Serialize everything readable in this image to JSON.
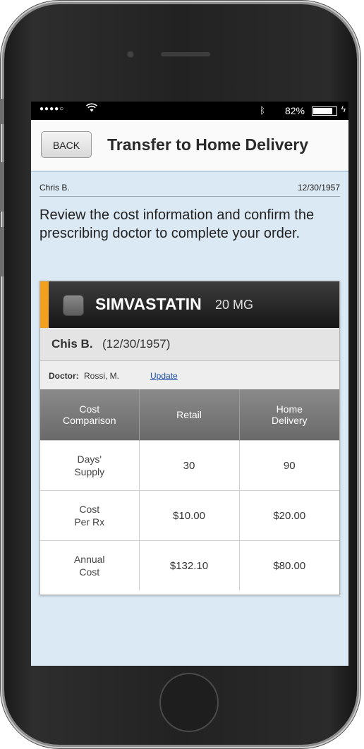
{
  "status_bar": {
    "signal": "●●●●○",
    "battery_percent": "82%",
    "battery_level": 0.82
  },
  "nav": {
    "back_label": "BACK",
    "title": "Transfer to Home Delivery"
  },
  "patient": {
    "name": "Chris B.",
    "dob": "12/30/1957"
  },
  "instructions": "Review the cost information and confirm the prescribing doctor to complete your order.",
  "prescription": {
    "drug_name": "SIMVASTATIN",
    "dose": "20 MG",
    "member_name": "Chis B.",
    "member_dob": "(12/30/1957)",
    "doctor_label": "Doctor:",
    "doctor_name": "Rossi, M.",
    "update_label": "Update",
    "accent_color": "#f2a01e"
  },
  "cost_table": {
    "headers": [
      "Cost\nComparison",
      "Retail",
      "Home\nDelivery"
    ],
    "rows": [
      {
        "label": "Days'\nSupply",
        "retail": "30",
        "home": "90"
      },
      {
        "label": "Cost\nPer Rx",
        "retail": "$10.00",
        "home": "$20.00"
      },
      {
        "label": "Annual\nCost",
        "retail": "$132.10",
        "home": "$80.00"
      }
    ]
  }
}
